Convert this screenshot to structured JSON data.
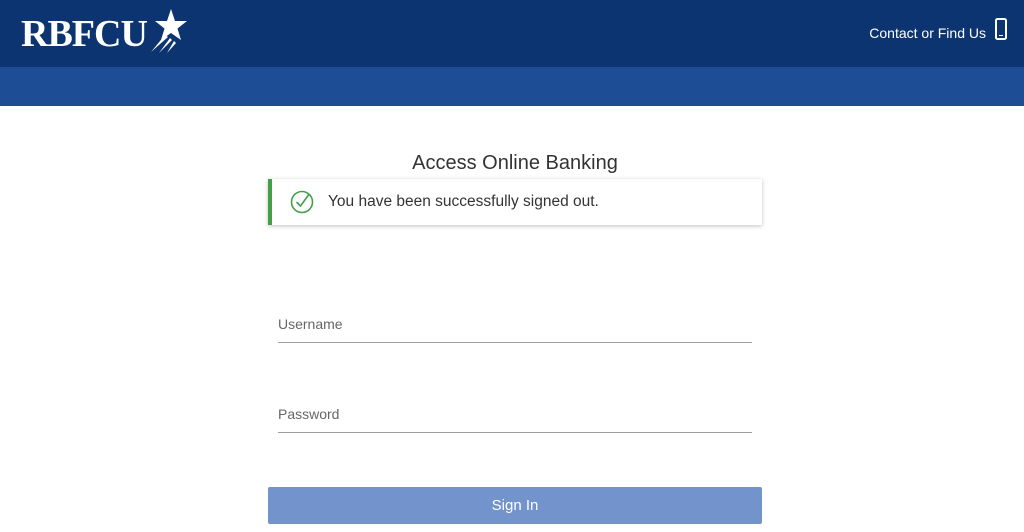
{
  "header": {
    "logo_text": "RBFCU",
    "contact_label": "Contact or Find Us",
    "contact_icon": "mobile-phone-icon",
    "colors": {
      "top_bar": "#0b3470",
      "band": "#1d4d94"
    }
  },
  "login": {
    "title": "Access Online Banking",
    "alert": {
      "message": "You have been successfully signed out.",
      "icon": "check-circle-icon",
      "accent_color": "#43a047"
    },
    "username": {
      "placeholder": "Username",
      "value": ""
    },
    "password": {
      "placeholder": "Password",
      "value": ""
    },
    "sign_in_label": "Sign In",
    "button_color": "#7393cc"
  }
}
